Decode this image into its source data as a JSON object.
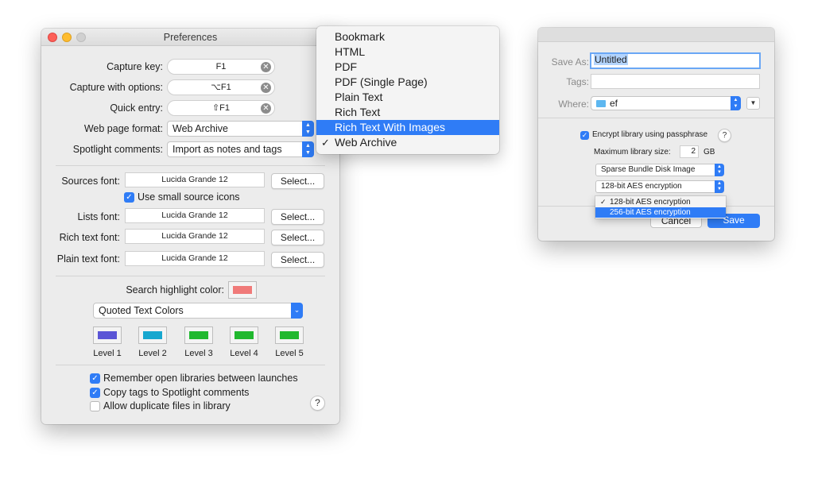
{
  "prefs": {
    "title": "Preferences",
    "capture_key_label": "Capture key:",
    "capture_key_value": "F1",
    "capture_opts_label": "Capture with options:",
    "capture_opts_value": "⌥F1",
    "quick_entry_label": "Quick entry:",
    "quick_entry_value": "⇧F1",
    "web_format_label": "Web page format:",
    "web_format_value": "Web Archive",
    "spotlight_label": "Spotlight comments:",
    "spotlight_value": "Import as notes and tags",
    "sources_font_label": "Sources font:",
    "sources_font_value": "Lucida Grande 12",
    "small_icons_label": "Use small source icons",
    "lists_font_label": "Lists font:",
    "lists_font_value": "Lucida Grande 12",
    "rich_font_label": "Rich text font:",
    "rich_font_value": "Lucida Grande 12",
    "plain_font_label": "Plain text font:",
    "plain_font_value": "Lucida Grande 12",
    "select_label": "Select...",
    "highlight_label": "Search highlight color:",
    "highlight_color": "#f07a79",
    "quoted_colors_value": "Quoted Text Colors",
    "levels": [
      {
        "label": "Level 1",
        "color": "#5b55d6"
      },
      {
        "label": "Level 2",
        "color": "#17a7cf"
      },
      {
        "label": "Level 3",
        "color": "#21b82f"
      },
      {
        "label": "Level 4",
        "color": "#21b82f"
      },
      {
        "label": "Level 5",
        "color": "#21b82f"
      }
    ],
    "remember_label": "Remember open libraries between launches",
    "copy_tags_label": "Copy tags to Spotlight comments",
    "allow_dup_label": "Allow duplicate files in library",
    "help_label": "?"
  },
  "format_menu": {
    "items": [
      "Bookmark",
      "HTML",
      "PDF",
      "PDF (Single Page)",
      "Plain Text",
      "Rich Text",
      "Rich Text With Images",
      "Web Archive"
    ],
    "highlighted": "Rich Text With Images",
    "checked": "Web Archive"
  },
  "save": {
    "save_as_label": "Save As:",
    "save_as_value": "Untitled",
    "tags_label": "Tags:",
    "where_label": "Where:",
    "where_value": "ef",
    "encrypt_label": "Encrypt library using passphrase",
    "max_size_label": "Maximum library size:",
    "max_size_value": "2",
    "max_size_unit": "GB",
    "image_type_value": "Sparse Bundle Disk Image",
    "encryption_value": "128-bit AES encryption",
    "encryption_options": [
      "128-bit AES encryption",
      "256-bit AES encryption"
    ],
    "cancel_label": "Cancel",
    "save_label": "Save",
    "help_label": "?"
  }
}
